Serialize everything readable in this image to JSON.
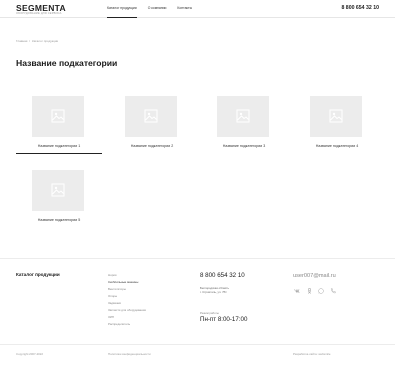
{
  "header": {
    "logo": "SEGMENTA",
    "logo_sub": "ОБОРУДОВАНИЕ ДЛЯ СЕРВИСА",
    "nav": [
      "Каталог продукции",
      "О компании",
      "Контакты"
    ],
    "phone": "8 800 654 32 10"
  },
  "breadcrumb": {
    "home": "Главная",
    "separator": "/",
    "current": "Каталог продукции"
  },
  "page_title": "Название подкатегории",
  "subcategories": [
    "Название подкатегории 1",
    "Название подкатегории 2",
    "Название подкатегории 3",
    "Название подкатегории 4",
    "Название подкатегории 5"
  ],
  "footer": {
    "catalog_title": "Каталог продукции",
    "links": [
      "Нория",
      "Скоблильные машины",
      "Вентиляторы",
      "Опоры",
      "Задвижки",
      "Запчасти для оборудования",
      "ЗИП",
      "Распределитель"
    ],
    "phone": "8 800 654 32 10",
    "address_line1": "Белгородская область",
    "address_line2": "г. Строитель, ул. 7Ю",
    "hours_label": "Режим работы",
    "hours": "Пн-пт 8:00-17:00",
    "email": "user007@mail.ru",
    "social_icons": [
      "vk-icon",
      "ok-icon",
      "whatsapp-icon",
      "viber-icon"
    ],
    "copyright": "Copyright 2007-2022",
    "policy": "Политика конфиденциальности",
    "developer": "Разработка сайта: websmile"
  },
  "colors": {
    "text": "#1a1a1a",
    "muted": "#999999",
    "placeholder": "#ececec",
    "accent_line": "#222222"
  }
}
